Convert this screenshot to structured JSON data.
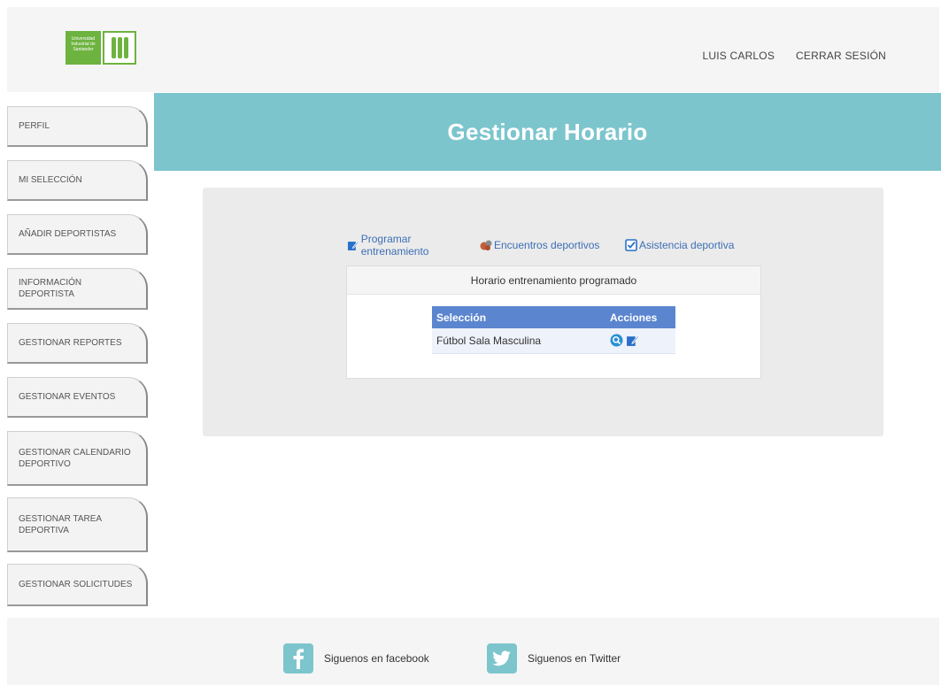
{
  "header": {
    "logo_text": "Universidad Industrial de Santander",
    "user_name": "LUIS CARLOS",
    "logout_label": "CERRAR SESIÓN"
  },
  "sidebar": {
    "items": [
      {
        "label": "PERFIL"
      },
      {
        "label": "MI SELECCIÓN"
      },
      {
        "label": "AÑADIR DEPORTISTAS"
      },
      {
        "label": "INFORMACIÓN DEPORTISTA"
      },
      {
        "label": "GESTIONAR REPORTES"
      },
      {
        "label": "GESTIONAR EVENTOS"
      },
      {
        "label": "GESTIONAR CALENDARIO DEPORTIVO"
      },
      {
        "label": "GESTIONAR TAREA DEPORTIVA"
      },
      {
        "label": "GESTIONAR SOLICITUDES"
      }
    ]
  },
  "page": {
    "title": "Gestionar Horario"
  },
  "actions": {
    "program_training": "Programar entrenamiento",
    "sports_matches": "Encuentros deportivos",
    "sports_attendance": "Asistencia deportiva"
  },
  "schedule_card": {
    "title": "Horario entrenamiento programado",
    "columns": [
      "Selección",
      "Acciones"
    ],
    "rows": [
      {
        "seleccion": "Fútbol Sala Masculina"
      }
    ]
  },
  "footer": {
    "facebook_label": "Siguenos en facebook",
    "twitter_label": "Siguenos en Twitter"
  },
  "colors": {
    "banner": "#7cc5cd",
    "table_header": "#5b85cf",
    "link": "#3d6fb5",
    "logo_green": "#6db33f"
  }
}
